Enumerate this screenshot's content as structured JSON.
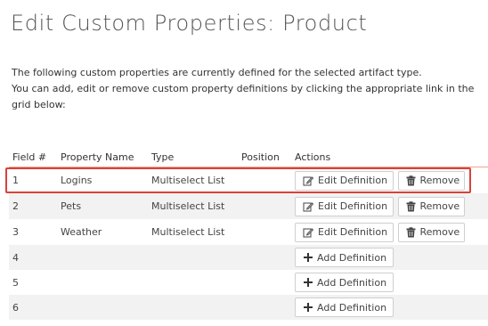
{
  "page": {
    "title": "Edit Custom Properties: Product",
    "description_line1": "The following custom properties are currently defined for the selected artifact type.",
    "description_line2": "You can add, edit or remove custom property definitions by clicking the appropriate link in the grid below:"
  },
  "grid": {
    "headers": {
      "field": "Field #",
      "name": "Property Name",
      "type": "Type",
      "position": "Position",
      "actions": "Actions"
    },
    "rows": [
      {
        "field": "1",
        "name": "Logins",
        "type": "Multiselect List",
        "position": ""
      },
      {
        "field": "2",
        "name": "Pets",
        "type": "Multiselect List",
        "position": ""
      },
      {
        "field": "3",
        "name": "Weather",
        "type": "Multiselect List",
        "position": ""
      },
      {
        "field": "4",
        "name": "",
        "type": "",
        "position": ""
      },
      {
        "field": "5",
        "name": "",
        "type": "",
        "position": ""
      },
      {
        "field": "6",
        "name": "",
        "type": "",
        "position": ""
      }
    ],
    "edit_label": "Edit Definition",
    "remove_label": "Remove",
    "add_label": "Add Definition"
  },
  "icons": {
    "edit": "edit-icon",
    "remove": "trash-icon",
    "add": "plus-icon"
  },
  "colors": {
    "highlight": "#d9413a",
    "header_rule": "#f0a58a",
    "alt_row": "#f2f2f2"
  }
}
